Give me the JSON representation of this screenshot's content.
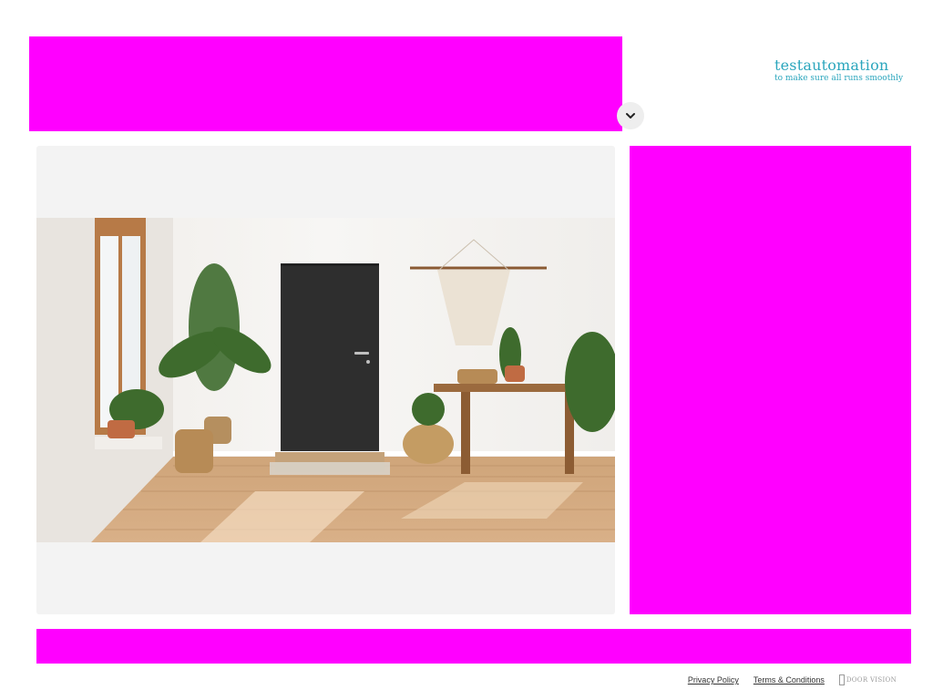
{
  "brand": {
    "name": "testautomation",
    "tagline": "to make sure all runs smoothly",
    "color": "#2ba6bd"
  },
  "header": {
    "dropdown_icon": "chevron-down-icon"
  },
  "viewer": {
    "scene_description_icon": "room-scene-image"
  },
  "footer": {
    "privacy_label": "Privacy Policy",
    "terms_label": "Terms & Conditions",
    "logo_text": "DOOR VISION"
  },
  "colors": {
    "mask": "#ff00ff",
    "viewer_bg": "#f3f3f3",
    "door": "#2e2e2e"
  }
}
